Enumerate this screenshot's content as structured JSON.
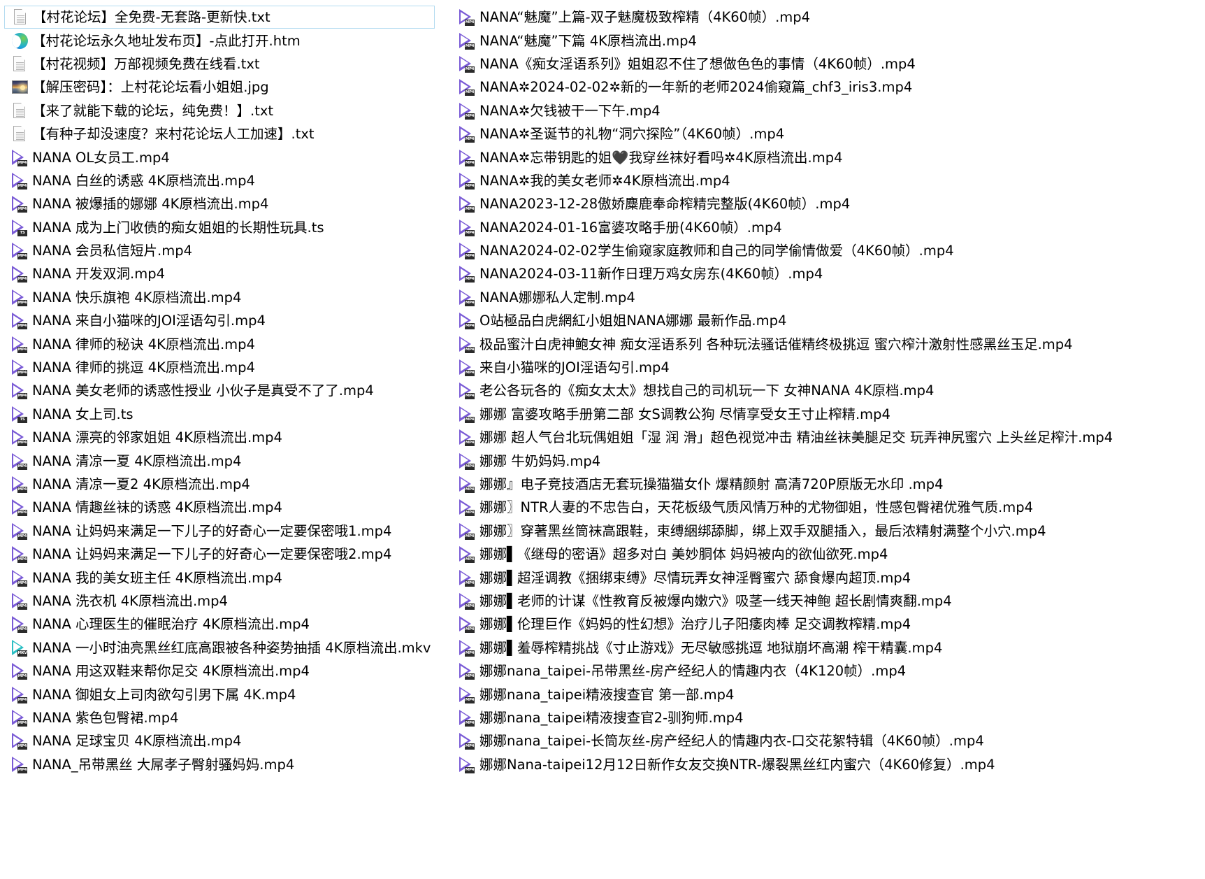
{
  "window": {
    "title": "File list",
    "background_color": "#ffffff",
    "selection_border_color": "#b3dbf0",
    "video_icon_color": "#7a5bd6",
    "mkv_icon_color": "#2bbfc4",
    "text_color": "#000000"
  },
  "columns": {
    "left": {
      "name": "left-file-column",
      "files": [
        {
          "name": "【村花论坛】全免费-无套路-更新快.txt",
          "icon": "text-file-icon",
          "type": "txt",
          "badge": "",
          "selected": true
        },
        {
          "name": "【村花论坛永久地址发布页】-点此打开.htm",
          "icon": "edge-browser-icon",
          "type": "htm",
          "badge": "",
          "selected": false
        },
        {
          "name": "【村花视频】万部视频免费在线看.txt",
          "icon": "text-file-icon",
          "type": "txt",
          "badge": "",
          "selected": false
        },
        {
          "name": "【解压密码】：上村花论坛看小姐姐.jpg",
          "icon": "image-thumbnail-icon",
          "type": "jpg",
          "badge": "",
          "selected": false
        },
        {
          "name": "【来了就能下载的论坛，纯免费！】.txt",
          "icon": "text-file-icon",
          "type": "txt",
          "badge": "",
          "selected": false
        },
        {
          "name": "【有种子却没速度？来村花论坛人工加速】.txt",
          "icon": "text-file-icon",
          "type": "txt",
          "badge": "",
          "selected": false
        },
        {
          "name": "NANA OL女员工.mp4",
          "icon": "video-file-icon",
          "type": "mp4",
          "badge": "MP4",
          "selected": false
        },
        {
          "name": "NANA 白丝的诱惑 4K原档流出.mp4",
          "icon": "video-file-icon",
          "type": "mp4",
          "badge": "MP4",
          "selected": false
        },
        {
          "name": "NANA 被爆插的娜娜 4K原档流出.mp4",
          "icon": "video-file-icon",
          "type": "mp4",
          "badge": "MP4",
          "selected": false
        },
        {
          "name": "NANA 成为上门收债的痴女姐姐的长期性玩具.ts",
          "icon": "video-file-icon",
          "type": "ts",
          "badge": "TS",
          "selected": false
        },
        {
          "name": "NANA 会员私信短片.mp4",
          "icon": "video-file-icon",
          "type": "mp4",
          "badge": "MP4",
          "selected": false
        },
        {
          "name": "NANA 开发双洞.mp4",
          "icon": "video-file-icon",
          "type": "mp4",
          "badge": "MP4",
          "selected": false
        },
        {
          "name": "NANA 快乐旗袍 4K原档流出.mp4",
          "icon": "video-file-icon",
          "type": "mp4",
          "badge": "MP4",
          "selected": false
        },
        {
          "name": "NANA 来自小猫咪的JOI淫语勾引.mp4",
          "icon": "video-file-icon",
          "type": "mp4",
          "badge": "MP4",
          "selected": false
        },
        {
          "name": "NANA 律师的秘诀 4K原档流出.mp4",
          "icon": "video-file-icon",
          "type": "mp4",
          "badge": "MP4",
          "selected": false
        },
        {
          "name": "NANA 律师的挑逗 4K原档流出.mp4",
          "icon": "video-file-icon",
          "type": "mp4",
          "badge": "MP4",
          "selected": false
        },
        {
          "name": "NANA 美女老师的诱惑性授业 小伙子是真受不了了.mp4",
          "icon": "video-file-icon",
          "type": "mp4",
          "badge": "MP4",
          "selected": false
        },
        {
          "name": "NANA 女上司.ts",
          "icon": "video-file-icon",
          "type": "ts",
          "badge": "TS",
          "selected": false
        },
        {
          "name": "NANA 漂亮的邻家姐姐 4K原档流出.mp4",
          "icon": "video-file-icon",
          "type": "mp4",
          "badge": "MP4",
          "selected": false
        },
        {
          "name": "NANA 清凉一夏 4K原档流出.mp4",
          "icon": "video-file-icon",
          "type": "mp4",
          "badge": "MP4",
          "selected": false
        },
        {
          "name": "NANA 清凉一夏2 4K原档流出.mp4",
          "icon": "video-file-icon",
          "type": "mp4",
          "badge": "MP4",
          "selected": false
        },
        {
          "name": "NANA 情趣丝袜的诱惑 4K原档流出.mp4",
          "icon": "video-file-icon",
          "type": "mp4",
          "badge": "MP4",
          "selected": false
        },
        {
          "name": "NANA 让妈妈来满足一下儿子的好奇心一定要保密哦1.mp4",
          "icon": "video-file-icon",
          "type": "mp4",
          "badge": "MP4",
          "selected": false
        },
        {
          "name": "NANA 让妈妈来满足一下儿子的好奇心一定要保密哦2.mp4",
          "icon": "video-file-icon",
          "type": "mp4",
          "badge": "MP4",
          "selected": false
        },
        {
          "name": "NANA 我的美女班主任 4K原档流出.mp4",
          "icon": "video-file-icon",
          "type": "mp4",
          "badge": "MP4",
          "selected": false
        },
        {
          "name": "NANA 洗衣机 4K原档流出.mp4",
          "icon": "video-file-icon",
          "type": "mp4",
          "badge": "MP4",
          "selected": false
        },
        {
          "name": "NANA 心理医生的催眠治疗 4K原档流出.mp4",
          "icon": "video-file-icon",
          "type": "mp4",
          "badge": "MP4",
          "selected": false
        },
        {
          "name": "NANA 一小时油亮黑丝红底高跟被各种姿势抽插 4K原档流出.mkv",
          "icon": "video-file-icon",
          "type": "mkv",
          "badge": "MKV",
          "selected": false
        },
        {
          "name": "NANA 用这双鞋来帮你足交 4K原档流出.mp4",
          "icon": "video-file-icon",
          "type": "mp4",
          "badge": "MP4",
          "selected": false
        },
        {
          "name": "NANA 御姐女上司肉欲勾引男下属 4K.mp4",
          "icon": "video-file-icon",
          "type": "mp4",
          "badge": "MP4",
          "selected": false
        },
        {
          "name": "NANA 紫色包臀裙.mp4",
          "icon": "video-file-icon",
          "type": "mp4",
          "badge": "MP4",
          "selected": false
        },
        {
          "name": "NANA 足球宝贝 4K原档流出.mp4",
          "icon": "video-file-icon",
          "type": "mp4",
          "badge": "MP4",
          "selected": false
        },
        {
          "name": "NANA_吊带黑丝 大屌孝子臀射骚妈妈.mp4",
          "icon": "video-file-icon",
          "type": "mp4",
          "badge": "MP4",
          "selected": false
        }
      ]
    },
    "right": {
      "name": "right-file-column",
      "files": [
        {
          "name": "NANA“魅魔”上篇-双子魅魔极致榨精（4K60帧）.mp4",
          "icon": "video-file-icon",
          "type": "mp4",
          "badge": "MP4",
          "selected": false
        },
        {
          "name": "NANA“魅魔”下篇 4K原档流出.mp4",
          "icon": "video-file-icon",
          "type": "mp4",
          "badge": "MP4",
          "selected": false
        },
        {
          "name": "NANA《痴女淫语系列》姐姐忍不住了想做色色的事情（4K60帧）.mp4",
          "icon": "video-file-icon",
          "type": "mp4",
          "badge": "MP4",
          "selected": false
        },
        {
          "name": "NANA✲2024-02-02✲新的一年新的老师2024偷窥篇_chf3_iris3.mp4",
          "icon": "video-file-icon",
          "type": "mp4",
          "badge": "MP4",
          "selected": false
        },
        {
          "name": "NANA✲欠钱被干一下午.mp4",
          "icon": "video-file-icon",
          "type": "mp4",
          "badge": "MP4",
          "selected": false
        },
        {
          "name": "NANA✲圣诞节的礼物“洞穴探险”（4K60帧）.mp4",
          "icon": "video-file-icon",
          "type": "mp4",
          "badge": "MP4",
          "selected": false
        },
        {
          "name": "NANA✲忘带钥匙的姐🖤我穿丝袜好看吗✲4K原档流出.mp4",
          "icon": "video-file-icon",
          "type": "mp4",
          "badge": "MP4",
          "selected": false
        },
        {
          "name": "NANA✲我的美女老师✲4K原档流出.mp4",
          "icon": "video-file-icon",
          "type": "mp4",
          "badge": "MP4",
          "selected": false
        },
        {
          "name": "NANA2023-12-28傲娇麋鹿奉命榨精完整版(4K60帧）.mp4",
          "icon": "video-file-icon",
          "type": "mp4",
          "badge": "MP4",
          "selected": false
        },
        {
          "name": "NANA2024-01-16富婆攻略手册(4K60帧）.mp4",
          "icon": "video-file-icon",
          "type": "mp4",
          "badge": "MP4",
          "selected": false
        },
        {
          "name": "NANA2024-02-02学生偷窥家庭教师和自己的同学偷情做爱（4K60帧）.mp4",
          "icon": "video-file-icon",
          "type": "mp4",
          "badge": "MP4",
          "selected": false
        },
        {
          "name": "NANA2024-03-11新作日理万鸡女房东(4K60帧）.mp4",
          "icon": "video-file-icon",
          "type": "mp4",
          "badge": "MP4",
          "selected": false
        },
        {
          "name": "NANA娜娜私人定制.mp4",
          "icon": "video-file-icon",
          "type": "mp4",
          "badge": "MP4",
          "selected": false
        },
        {
          "name": "O站極品白虎網紅小姐姐NANA娜娜 最新作品.mp4",
          "icon": "video-file-icon",
          "type": "mp4",
          "badge": "MP4",
          "selected": false
        },
        {
          "name": "极品蜜汁白虎神鲍女神 痴女淫语系列 各种玩法骚话催精终极挑逗 蜜穴榨汁激射性感黑丝玉足.mp4",
          "icon": "video-file-icon",
          "type": "mp4",
          "badge": "MP4",
          "selected": false
        },
        {
          "name": "来自小猫咪的JOI淫语勾引.mp4",
          "icon": "video-file-icon",
          "type": "mp4",
          "badge": "MP4",
          "selected": false
        },
        {
          "name": "老公各玩各的《痴女太太》想找自己的司机玩一下 女神NANA 4K原档.mp4",
          "icon": "video-file-icon",
          "type": "mp4",
          "badge": "MP4",
          "selected": false
        },
        {
          "name": "娜娜 富婆攻略手册第二部 女S调教公狗 尽情享受女王寸止榨精.mp4",
          "icon": "video-file-icon",
          "type": "mp4",
          "badge": "MP4",
          "selected": false
        },
        {
          "name": "娜娜 超人气台北玩偶姐姐「湿 润 滑」超色视觉冲击 精油丝袜美腿足交 玩弄神尻蜜穴 上头丝足榨汁.mp4",
          "icon": "video-file-icon",
          "type": "mp4",
          "badge": "MP4",
          "selected": false
        },
        {
          "name": "娜娜 牛奶妈妈.mp4",
          "icon": "video-file-icon",
          "type": "mp4",
          "badge": "MP4",
          "selected": false
        },
        {
          "name": "娜娜』电子竞技酒店无套玩操猫猫女仆 爆精颜射 高清720P原版无水印 .mp4",
          "icon": "video-file-icon",
          "type": "mp4",
          "badge": "MP4",
          "selected": false
        },
        {
          "name": "娜娜〗NTR人妻的不忠告白，天花板级气质风情万种的尤物御姐，性感包臀裙优雅气质.mp4",
          "icon": "video-file-icon",
          "type": "mp4",
          "badge": "MP4",
          "selected": false
        },
        {
          "name": "娜娜〗穿著黑丝筒袜高跟鞋，束缚綑绑舔脚，绑上双手双腿插入，最后浓精射满整个小穴.mp4",
          "icon": "video-file-icon",
          "type": "mp4",
          "badge": "MP4",
          "selected": false
        },
        {
          "name": "娜娜▌《继母的密语》超多对白 美妙胴体 妈妈被禸的欲仙欲死.mp4",
          "icon": "video-file-icon",
          "type": "mp4",
          "badge": "MP4",
          "selected": false
        },
        {
          "name": "娜娜▌超淫调教《捆绑束缚》尽情玩弄女神淫臀蜜穴 舔食爆禸超顶.mp4",
          "icon": "video-file-icon",
          "type": "mp4",
          "badge": "MP4",
          "selected": false
        },
        {
          "name": "娜娜▌老师的计谋《性教育反被爆禸嫩穴》吸茎一线天神鲍 超长剧情爽翻.mp4",
          "icon": "video-file-icon",
          "type": "mp4",
          "badge": "MP4",
          "selected": false
        },
        {
          "name": "娜娜▌伦理巨作《妈妈的性幻想》治疗儿子阳痿肉棒 足交调教榨精.mp4",
          "icon": "video-file-icon",
          "type": "mp4",
          "badge": "MP4",
          "selected": false
        },
        {
          "name": "娜娜▌羞辱榨精挑战《寸止游戏》无尽敏感挑逗 地狱崩坏高潮 榨干精囊.mp4",
          "icon": "video-file-icon",
          "type": "mp4",
          "badge": "MP4",
          "selected": false
        },
        {
          "name": "娜娜nana_taipei-吊带黑丝-房产经纪人的情趣内衣（4K120帧）.mp4",
          "icon": "video-file-icon",
          "type": "mp4",
          "badge": "MP4",
          "selected": false
        },
        {
          "name": "娜娜nana_taipei精液搜查官 第一部.mp4",
          "icon": "video-file-icon",
          "type": "mp4",
          "badge": "MP4",
          "selected": false
        },
        {
          "name": "娜娜nana_taipei精液搜查官2-驯狗师.mp4",
          "icon": "video-file-icon",
          "type": "mp4",
          "badge": "MP4",
          "selected": false
        },
        {
          "name": "娜娜nana_taipei-长筒灰丝-房产经纪人的情趣内衣-口交花絮特辑（4K60帧）.mp4",
          "icon": "video-file-icon",
          "type": "mp4",
          "badge": "MP4",
          "selected": false
        },
        {
          "name": "娜娜Nana-taipei12月12日新作女友交换NTR-爆裂黑丝红内蜜穴（4K60修复）.mp4",
          "icon": "video-file-icon",
          "type": "mp4",
          "badge": "MP4",
          "selected": false
        }
      ]
    }
  }
}
